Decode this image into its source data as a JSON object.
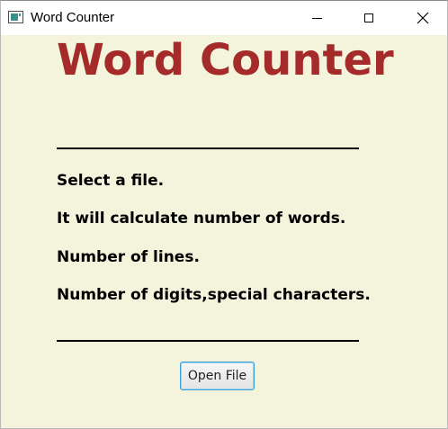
{
  "window": {
    "title": "Word Counter",
    "controls": [
      "minimize",
      "maximize",
      "close"
    ]
  },
  "main": {
    "heading": "Word Counter",
    "instructions": [
      "Select a file.",
      "It will calculate number of words.",
      "Number of lines.",
      "Number of digits,special characters."
    ],
    "open_button_label": "Open File"
  },
  "icons": {
    "app": "app-window-icon",
    "minimize": "minimize-icon",
    "maximize": "maximize-icon",
    "close": "close-icon"
  },
  "colors": {
    "background": "#f4f3dc",
    "heading": "#a52a2a",
    "button_focus": "#3c9fd6"
  }
}
